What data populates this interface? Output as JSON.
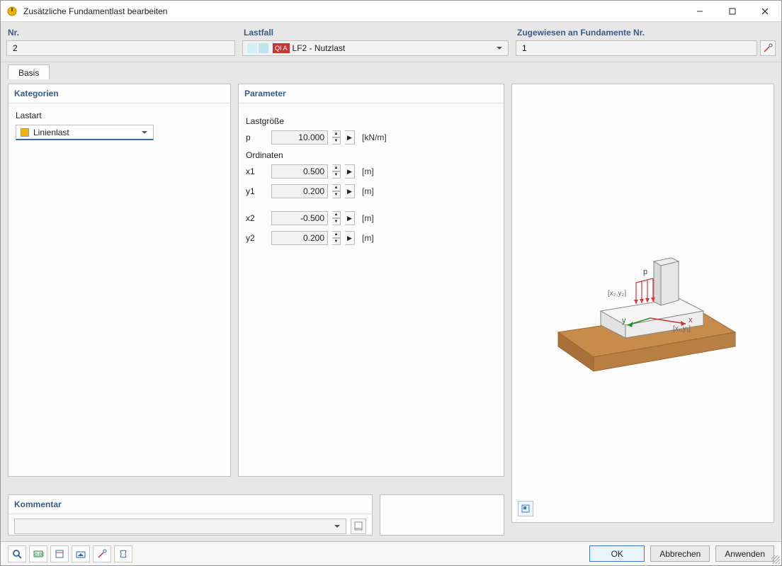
{
  "window": {
    "title": "Zusätzliche Fundamentlast bearbeiten"
  },
  "top": {
    "nr_label": "Nr.",
    "nr_value": "2",
    "lastfall_label": "Lastfall",
    "lastfall_badge": "QI A",
    "lastfall_value": "LF2 - Nutzlast",
    "assign_label": "Zugewiesen an Fundamente Nr.",
    "assign_value": "1"
  },
  "tabs": {
    "basis": "Basis"
  },
  "kategorien": {
    "header": "Kategorien",
    "lastart_label": "Lastart",
    "lastart_value": "Linienlast"
  },
  "parameter": {
    "header": "Parameter",
    "lastgroesse_label": "Lastgröße",
    "p_label": "p",
    "p_value": "10.000",
    "p_unit": "[kN/m]",
    "ordinaten_label": "Ordinaten",
    "x1_label": "x1",
    "x1_value": "0.500",
    "x1_unit": "[m]",
    "y1_label": "y1",
    "y1_value": "0.200",
    "y1_unit": "[m]",
    "x2_label": "x2",
    "x2_value": "-0.500",
    "x2_unit": "[m]",
    "y2_label": "y2",
    "y2_value": "0.200",
    "y2_unit": "[m]"
  },
  "kommentar": {
    "header": "Kommentar"
  },
  "preview": {
    "p": "p",
    "xy2": "[x₂,y₂]",
    "xy1": "[x₁,y₁]",
    "x": "x",
    "y": "y"
  },
  "footer": {
    "ok": "OK",
    "cancel": "Abbrechen",
    "apply": "Anwenden"
  }
}
